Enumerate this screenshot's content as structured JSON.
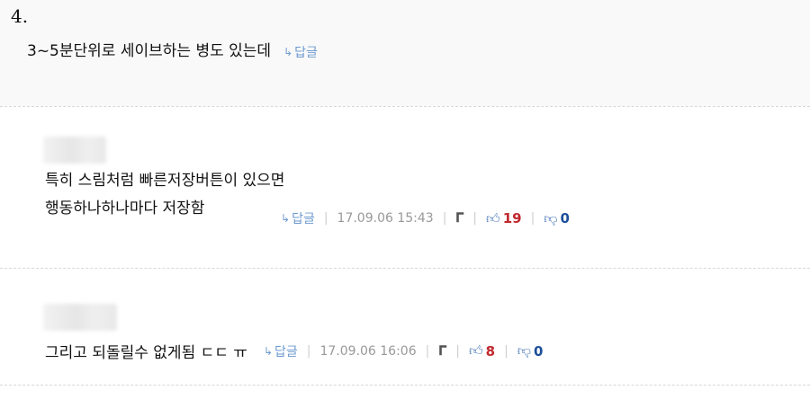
{
  "top_comment": {
    "number": "4.",
    "text": "3~5분단위로 세이브하는 병도 있는데",
    "reply_label": "답글"
  },
  "comments": [
    {
      "line1": "특히 스림처럼 빠른저장버튼이 있으면",
      "line2": "행동하나하나마다 저장함",
      "reply_label": "답글",
      "date": "17.09.06 15:43",
      "likes": "19",
      "dislikes": "0"
    },
    {
      "line1": "그리고 되돌릴수 없게됨 ㄷㄷ ㅠ",
      "reply_label": "답글",
      "date": "17.09.06 16:06",
      "likes": "8",
      "dislikes": "0"
    }
  ],
  "icons": {
    "reply": "reply-arrow-icon",
    "report": "bell-icon",
    "like": "thumbs-up-icon",
    "dislike": "thumbs-down-icon"
  },
  "colors": {
    "reply_link": "#6e9ad0",
    "like_count": "#c0282d",
    "dislike_count": "#1d4f9a",
    "date": "#999999"
  }
}
